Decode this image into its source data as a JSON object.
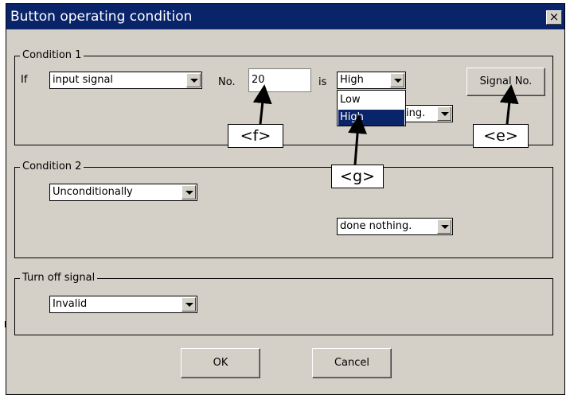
{
  "dialog": {
    "title": "Button operating condition",
    "close_glyph": "×"
  },
  "condition1": {
    "legend": "Condition 1",
    "if_label": "If",
    "subject_value": "input signal",
    "no_label": "No.",
    "no_value": "20",
    "is_label": "is",
    "state_value": "High",
    "state_options": [
      "Low",
      "High"
    ],
    "state_selected": "High",
    "action_partial": "ing.",
    "signal_button": "Signal No."
  },
  "condition2": {
    "legend": "Condition 2",
    "subject_value": "Unconditionally",
    "action_value": "done nothing."
  },
  "turnoff": {
    "legend": "Turn off signal",
    "value": "Invalid"
  },
  "buttons": {
    "ok": "OK",
    "cancel": "Cancel"
  },
  "callouts": {
    "e": "<e>",
    "f": "<f>",
    "g": "<g>"
  },
  "colors": {
    "titlebar": "#0a246a",
    "dialog_bg": "#d4d0c8",
    "selection": "#0a246a"
  },
  "icons": {
    "close": "close-icon",
    "dropdown": "chevron-down-icon"
  }
}
